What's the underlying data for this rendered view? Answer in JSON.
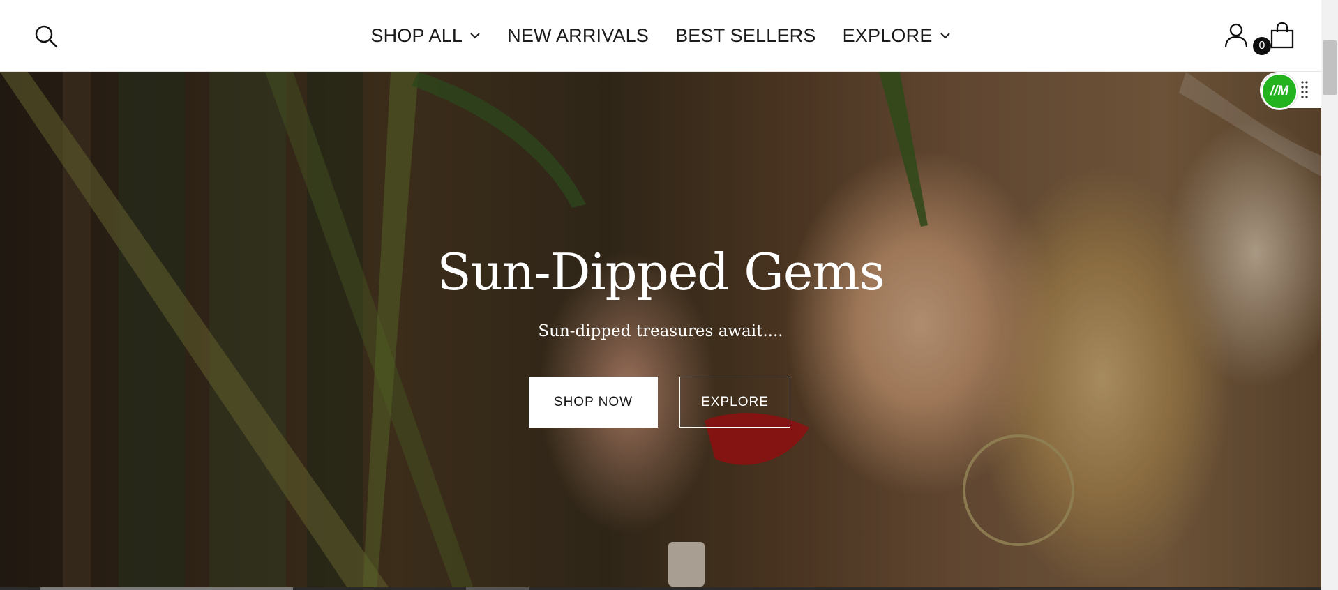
{
  "header": {
    "nav": [
      {
        "label": "SHOP ALL",
        "has_dropdown": true
      },
      {
        "label": "NEW ARRIVALS",
        "has_dropdown": false
      },
      {
        "label": "BEST SELLERS",
        "has_dropdown": false
      },
      {
        "label": "EXPLORE",
        "has_dropdown": true
      }
    ],
    "cart_count": "0",
    "icons": {
      "search": "search-icon",
      "account": "user-icon",
      "cart": "shopping-bag-icon",
      "chevron": "chevron-down-icon"
    }
  },
  "hero": {
    "title": "Sun-Dipped Gems",
    "subtitle": "Sun-dipped treasures await....",
    "primary_button": "SHOP NOW",
    "secondary_button": "EXPLORE"
  },
  "widget": {
    "logo_text": "//M",
    "icons": {
      "handle": "drag-handle-icon"
    }
  },
  "colors": {
    "header_bg": "#ffffff",
    "nav_text": "#1b1b1b",
    "hero_text": "#ffffff",
    "widget_green": "#22b31f",
    "badge_bg": "#0f0f0f"
  }
}
